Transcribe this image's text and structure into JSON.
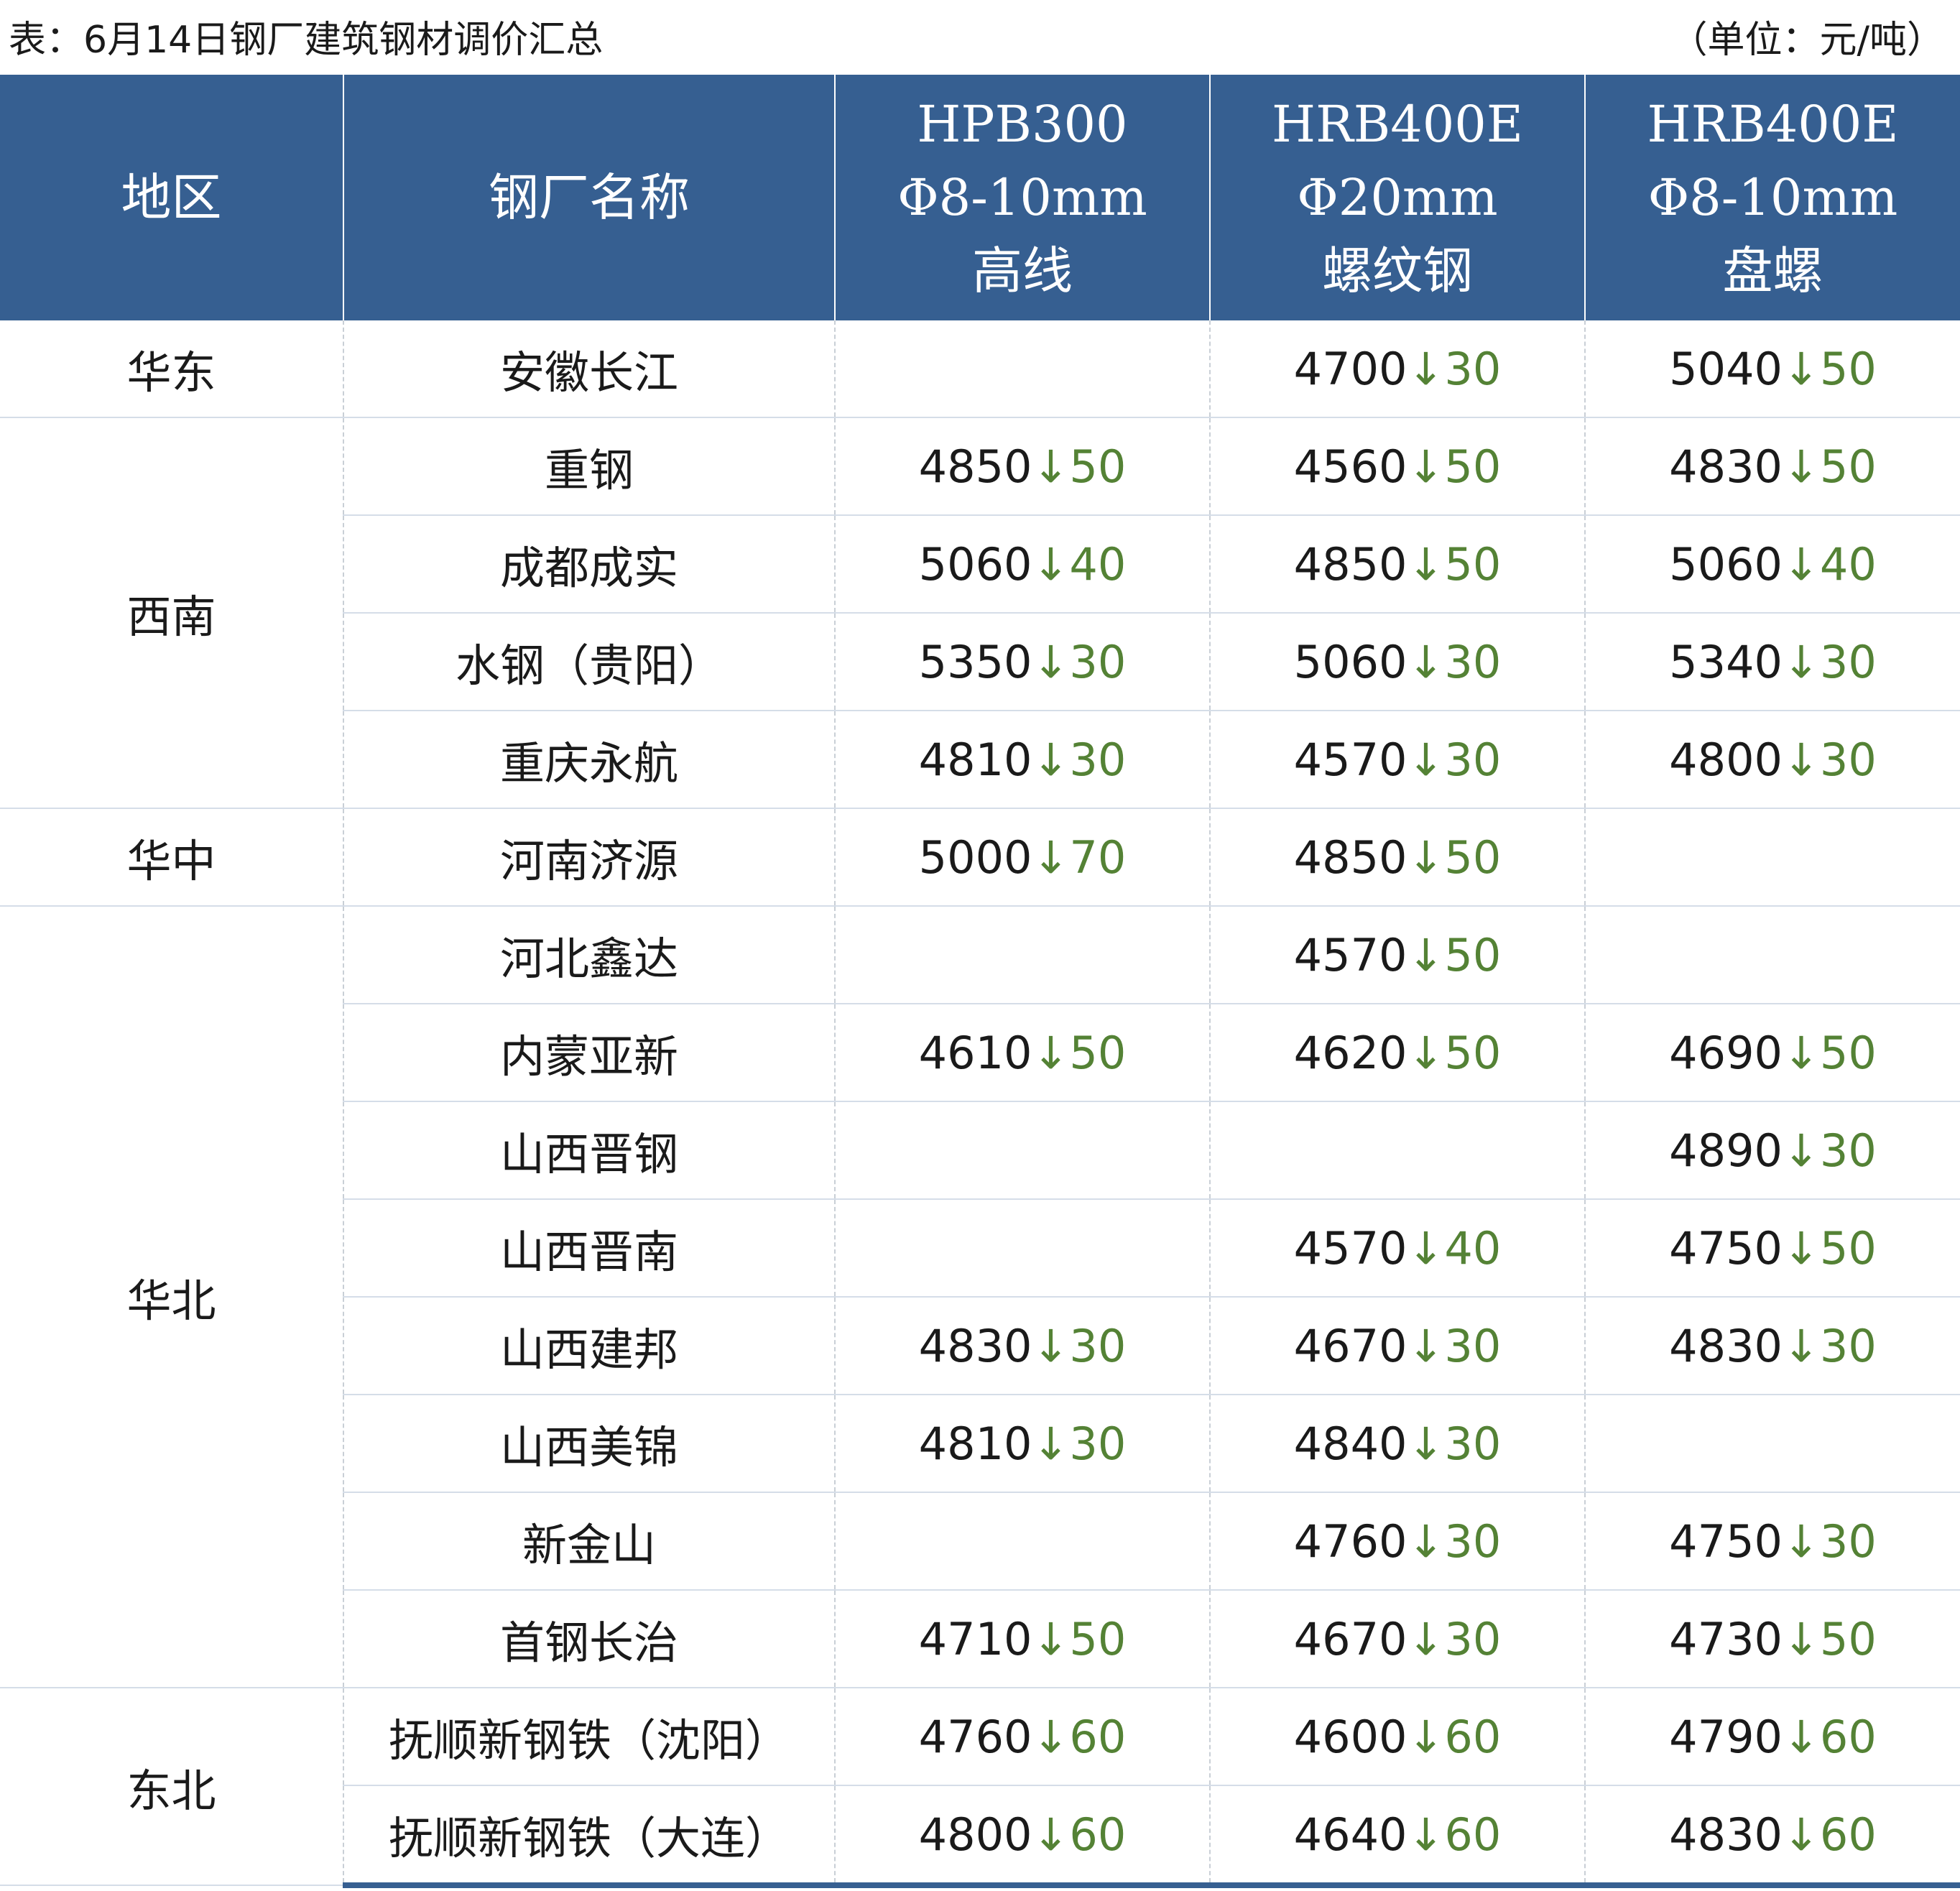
{
  "caption": "表：6月14日钢厂建筑钢材调价汇总",
  "unit": "（单位：元/吨）",
  "colors": {
    "header_bg": "#365f91",
    "down": "#548235"
  },
  "arrow_glyph": "↓",
  "header": {
    "region": "地区",
    "mill": "钢厂名称",
    "col1": {
      "line1": "HPB300",
      "line2": "Φ8-10mm",
      "line3": "高线"
    },
    "col2": {
      "line1": "HRB400E",
      "line2": "Φ20mm",
      "line3": "螺纹钢"
    },
    "col3": {
      "line1": "HRB400E",
      "line2": "Φ8-10mm",
      "line3": "盘螺"
    }
  },
  "groups": [
    {
      "region": "华东",
      "rows": [
        {
          "mill": "安徽长江",
          "p1": null,
          "p2": {
            "v": "4700",
            "c": "30"
          },
          "p3": {
            "v": "5040",
            "c": "50"
          }
        }
      ]
    },
    {
      "region": "西南",
      "rows": [
        {
          "mill": "重钢",
          "p1": {
            "v": "4850",
            "c": "50"
          },
          "p2": {
            "v": "4560",
            "c": "50"
          },
          "p3": {
            "v": "4830",
            "c": "50"
          }
        },
        {
          "mill": "成都成实",
          "p1": {
            "v": "5060",
            "c": "40"
          },
          "p2": {
            "v": "4850",
            "c": "50"
          },
          "p3": {
            "v": "5060",
            "c": "40"
          }
        },
        {
          "mill": "水钢（贵阳）",
          "p1": {
            "v": "5350",
            "c": "30"
          },
          "p2": {
            "v": "5060",
            "c": "30"
          },
          "p3": {
            "v": "5340",
            "c": "30"
          }
        },
        {
          "mill": "重庆永航",
          "p1": {
            "v": "4810",
            "c": "30"
          },
          "p2": {
            "v": "4570",
            "c": "30"
          },
          "p3": {
            "v": "4800",
            "c": "30"
          }
        }
      ]
    },
    {
      "region": "华中",
      "rows": [
        {
          "mill": "河南济源",
          "p1": {
            "v": "5000",
            "c": "70"
          },
          "p2": {
            "v": "4850",
            "c": "50"
          },
          "p3": null
        }
      ]
    },
    {
      "region": "华北",
      "rows": [
        {
          "mill": "河北鑫达",
          "p1": null,
          "p2": {
            "v": "4570",
            "c": "50"
          },
          "p3": null
        },
        {
          "mill": "内蒙亚新",
          "p1": {
            "v": "4610",
            "c": "50"
          },
          "p2": {
            "v": "4620",
            "c": "50"
          },
          "p3": {
            "v": "4690",
            "c": "50"
          }
        },
        {
          "mill": "山西晋钢",
          "p1": null,
          "p2": null,
          "p3": {
            "v": "4890",
            "c": "30"
          }
        },
        {
          "mill": "山西晋南",
          "p1": null,
          "p2": {
            "v": "4570",
            "c": "40"
          },
          "p3": {
            "v": "4750",
            "c": "50"
          }
        },
        {
          "mill": "山西建邦",
          "p1": {
            "v": "4830",
            "c": "30"
          },
          "p2": {
            "v": "4670",
            "c": "30"
          },
          "p3": {
            "v": "4830",
            "c": "30"
          }
        },
        {
          "mill": "山西美锦",
          "p1": {
            "v": "4810",
            "c": "30"
          },
          "p2": {
            "v": "4840",
            "c": "30"
          },
          "p3": null
        },
        {
          "mill": "新金山",
          "p1": null,
          "p2": {
            "v": "4760",
            "c": "30"
          },
          "p3": {
            "v": "4750",
            "c": "30"
          }
        },
        {
          "mill": "首钢长治",
          "p1": {
            "v": "4710",
            "c": "50"
          },
          "p2": {
            "v": "4670",
            "c": "30"
          },
          "p3": {
            "v": "4730",
            "c": "50"
          }
        }
      ]
    },
    {
      "region": "东北",
      "rows": [
        {
          "mill": "抚顺新钢铁（沈阳）",
          "p1": {
            "v": "4760",
            "c": "60"
          },
          "p2": {
            "v": "4600",
            "c": "60"
          },
          "p3": {
            "v": "4790",
            "c": "60"
          }
        },
        {
          "mill": "抚顺新钢铁（大连）",
          "p1": {
            "v": "4800",
            "c": "60"
          },
          "p2": {
            "v": "4640",
            "c": "60"
          },
          "p3": {
            "v": "4830",
            "c": "60"
          }
        }
      ]
    }
  ]
}
